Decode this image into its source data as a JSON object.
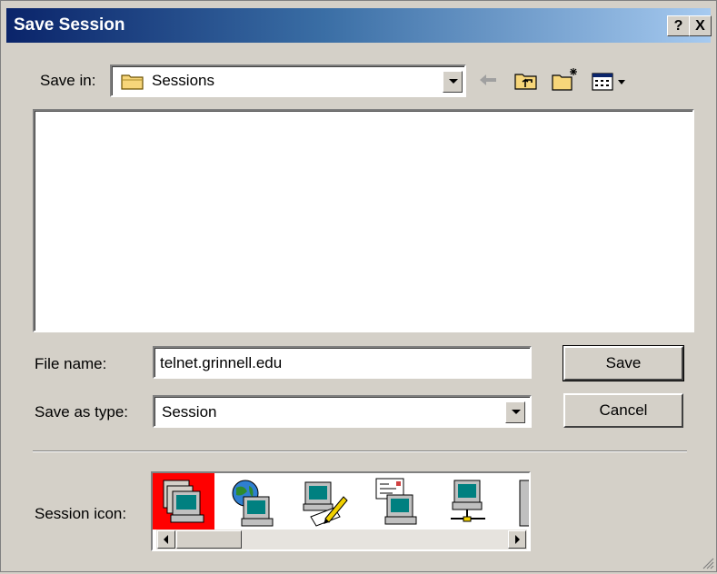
{
  "window": {
    "title": "Save Session",
    "help_label": "?",
    "close_label": "X"
  },
  "toolbar": {
    "save_in_label": "Save in:",
    "save_in_value": "Sessions",
    "back_icon": "back-arrow-icon",
    "up_icon": "up-one-level-icon",
    "new_folder_icon": "new-folder-icon",
    "view_icon": "view-menu-icon"
  },
  "form": {
    "file_name_label": "File name:",
    "file_name_value": "telnet.grinnell.edu",
    "save_as_type_label": "Save as type:",
    "save_as_type_value": "Session",
    "save_button": "Save",
    "cancel_button": "Cancel",
    "session_icon_label": "Session icon:"
  },
  "session_icons": [
    {
      "name": "terminal-stack-icon",
      "selected": true
    },
    {
      "name": "globe-computer-icon",
      "selected": false
    },
    {
      "name": "computer-pencil-icon",
      "selected": false
    },
    {
      "name": "document-computer-icon",
      "selected": false
    },
    {
      "name": "network-computer-icon",
      "selected": false
    }
  ],
  "colors": {
    "title_bar_start": "#0a246a",
    "title_bar_end": "#a6caf0",
    "selected_icon_bg": "#ff0000",
    "dialog_bg": "#d4d0c8"
  }
}
